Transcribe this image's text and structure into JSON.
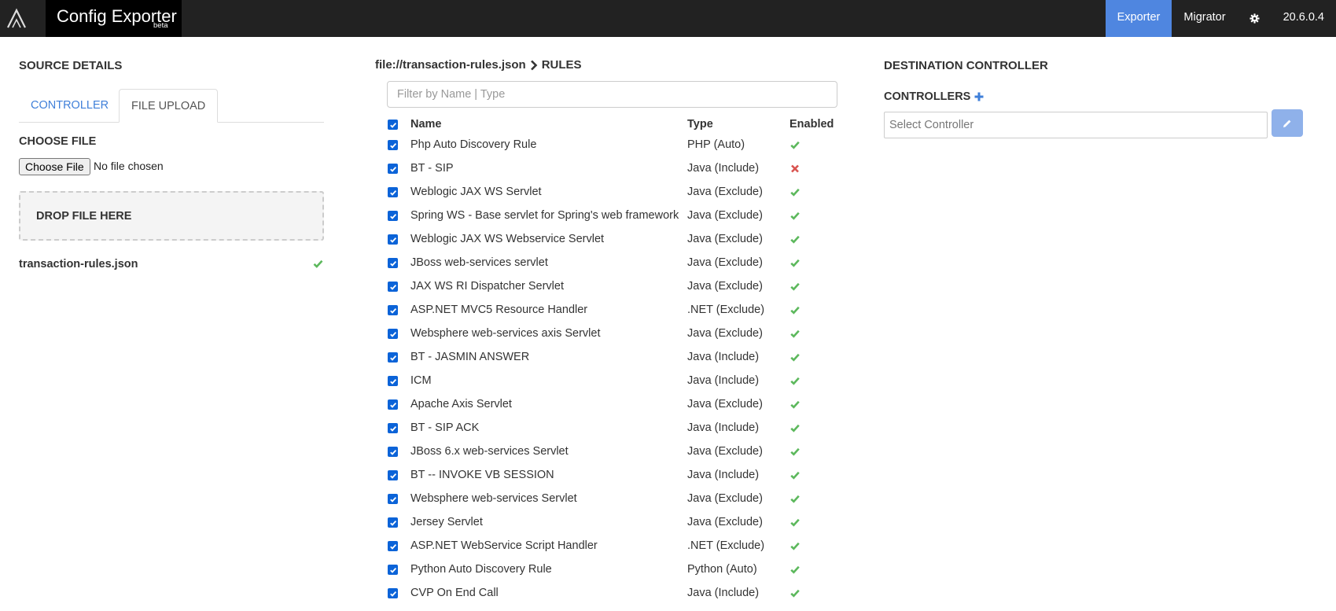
{
  "navbar": {
    "brand_title": "Config Exporter",
    "brand_badge": "beta",
    "items": [
      {
        "label": "Exporter",
        "active": true
      },
      {
        "label": "Migrator",
        "active": false
      }
    ],
    "settings_icon": "gear-icon",
    "version": "20.6.0.4",
    "active_color": "#4f86e0"
  },
  "source": {
    "title": "SOURCE DETAILS",
    "tabs": [
      {
        "label": "CONTROLLER",
        "active": false
      },
      {
        "label": "FILE UPLOAD",
        "active": true
      }
    ],
    "choose_file_title": "CHOOSE FILE",
    "choose_file_button": "Choose File",
    "file_status": "No file chosen",
    "drop_zone_label": "DROP FILE HERE",
    "uploaded_file": "transaction-rules.json",
    "uploaded_status_icon": "check-icon"
  },
  "rules": {
    "breadcrumb_file": "file://transaction-rules.json",
    "breadcrumb_section": "RULES",
    "filter_placeholder": "Filter by Name | Type",
    "filter_value": "",
    "headers": {
      "name": "Name",
      "type": "Type",
      "enabled": "Enabled"
    },
    "rows": [
      {
        "name": "Php Auto Discovery Rule",
        "type": "PHP (Auto)",
        "enabled": true
      },
      {
        "name": "BT - SIP",
        "type": "Java (Include)",
        "enabled": false
      },
      {
        "name": "Weblogic JAX WS Servlet",
        "type": "Java (Exclude)",
        "enabled": true
      },
      {
        "name": "Spring WS - Base servlet for Spring's web framework",
        "type": "Java (Exclude)",
        "enabled": true
      },
      {
        "name": "Weblogic JAX WS Webservice Servlet",
        "type": "Java (Exclude)",
        "enabled": true
      },
      {
        "name": "JBoss web-services servlet",
        "type": "Java (Exclude)",
        "enabled": true
      },
      {
        "name": "JAX WS RI Dispatcher Servlet",
        "type": "Java (Exclude)",
        "enabled": true
      },
      {
        "name": "ASP.NET MVC5 Resource Handler",
        "type": ".NET (Exclude)",
        "enabled": true
      },
      {
        "name": "Websphere web-services axis Servlet",
        "type": "Java (Exclude)",
        "enabled": true
      },
      {
        "name": "BT - JASMIN ANSWER",
        "type": "Java (Include)",
        "enabled": true
      },
      {
        "name": "ICM",
        "type": "Java (Include)",
        "enabled": true
      },
      {
        "name": "Apache Axis Servlet",
        "type": "Java (Exclude)",
        "enabled": true
      },
      {
        "name": "BT - SIP ACK",
        "type": "Java (Include)",
        "enabled": true
      },
      {
        "name": "JBoss 6.x web-services Servlet",
        "type": "Java (Exclude)",
        "enabled": true
      },
      {
        "name": "BT -- INVOKE VB SESSION",
        "type": "Java (Include)",
        "enabled": true
      },
      {
        "name": "Websphere web-services Servlet",
        "type": "Java (Exclude)",
        "enabled": true
      },
      {
        "name": "Jersey Servlet",
        "type": "Java (Exclude)",
        "enabled": true
      },
      {
        "name": "ASP.NET WebService Script Handler",
        "type": ".NET (Exclude)",
        "enabled": true
      },
      {
        "name": "Python Auto Discovery Rule",
        "type": "Python (Auto)",
        "enabled": true
      },
      {
        "name": "CVP On End Call",
        "type": "Java (Include)",
        "enabled": true
      }
    ],
    "enabled_color": "#5cb85c",
    "disabled_color": "#d9534f"
  },
  "destination": {
    "title": "DESTINATION CONTROLLER",
    "controllers_label": "CONTROLLERS",
    "add_icon": "plus-icon",
    "select_placeholder": "Select Controller",
    "edit_icon": "pencil-icon"
  }
}
